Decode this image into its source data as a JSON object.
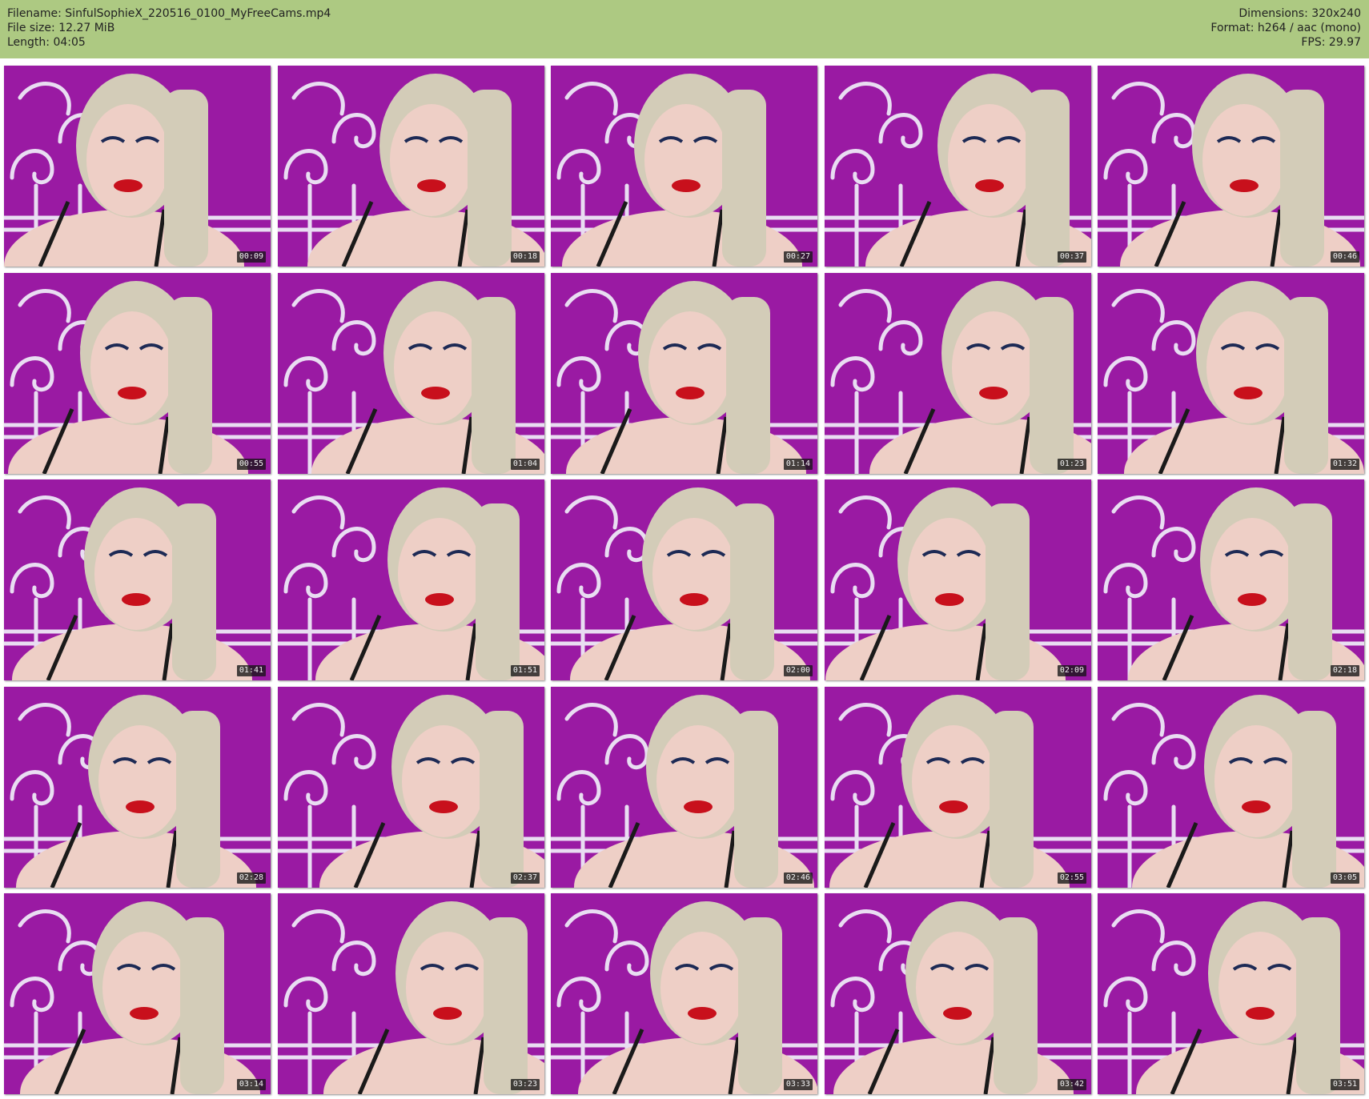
{
  "header": {
    "filename_label": "Filename: SinfulSophieX_220516_0100_MyFreeCams.mp4",
    "filesize_label": "File size: 12.27 MiB",
    "length_label": "Length: 04:05",
    "dimensions_label": "Dimensions: 320x240",
    "format_label": "Format: h264 / aac (mono)",
    "fps_label": "FPS: 29.97"
  },
  "colors": {
    "header_bg": "#adc982",
    "backdrop": "#9a1aa3",
    "ironwork": "#e9ddf2",
    "hair": "#d3ccb8",
    "skin": "#eecfc6",
    "lips": "#c8101c"
  },
  "thumbnails": [
    {
      "timestamp": "00:09"
    },
    {
      "timestamp": "00:18"
    },
    {
      "timestamp": "00:27"
    },
    {
      "timestamp": "00:37"
    },
    {
      "timestamp": "00:46"
    },
    {
      "timestamp": "00:55"
    },
    {
      "timestamp": "01:04"
    },
    {
      "timestamp": "01:14"
    },
    {
      "timestamp": "01:23"
    },
    {
      "timestamp": "01:32"
    },
    {
      "timestamp": "01:41"
    },
    {
      "timestamp": "01:51"
    },
    {
      "timestamp": "02:00"
    },
    {
      "timestamp": "02:09"
    },
    {
      "timestamp": "02:18"
    },
    {
      "timestamp": "02:28"
    },
    {
      "timestamp": "02:37"
    },
    {
      "timestamp": "02:46"
    },
    {
      "timestamp": "02:55"
    },
    {
      "timestamp": "03:05"
    },
    {
      "timestamp": "03:14"
    },
    {
      "timestamp": "03:23"
    },
    {
      "timestamp": "03:33"
    },
    {
      "timestamp": "03:42"
    },
    {
      "timestamp": "03:51"
    }
  ]
}
